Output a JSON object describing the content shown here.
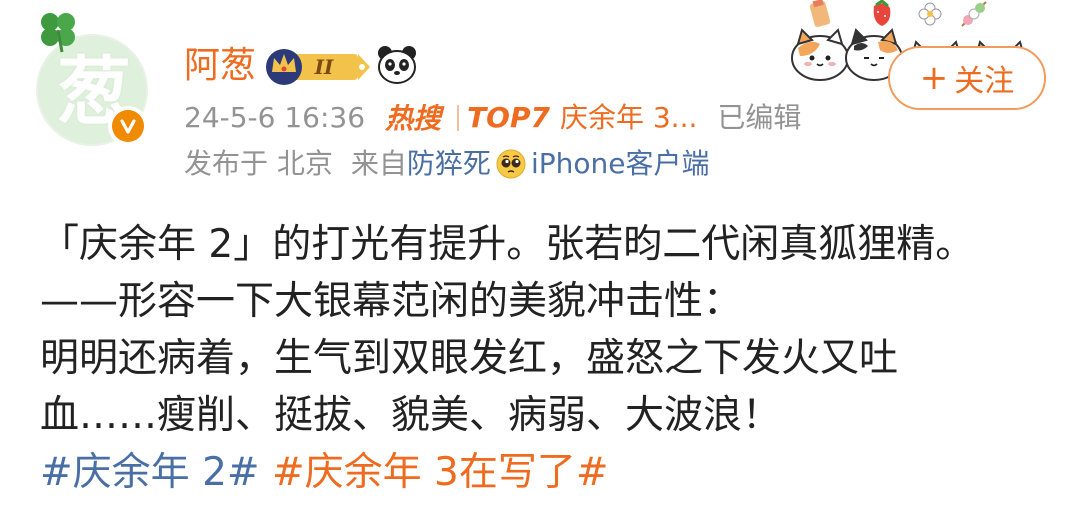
{
  "author": {
    "name": "阿葱",
    "avatar_glyph": "葱",
    "rank_badge": "II",
    "verified_mark": "v"
  },
  "meta": {
    "timestamp": "24-5-6 16:36",
    "hot_search_logo": "热搜",
    "hot_rank": "TOP7",
    "hot_topic": "庆余年 3...",
    "edited": "已编辑",
    "location": "发布于 北京",
    "source_prefix": "来自",
    "source_name": "防猝死",
    "source_suffix": "iPhone客户端"
  },
  "follow_button": {
    "plus": "+",
    "label": "关注"
  },
  "post": {
    "lines": [
      "「庆余年 2」的打光有提升。张若昀二代闲真狐狸精。",
      "——形容一下大银幕范闲的美貌冲击性：",
      "明明还病着，生气到双眼发红，盛怒之下发火又吐",
      "血……瘦削、挺拔、貌美、病弱、大波浪！"
    ],
    "tags": [
      {
        "text": "#庆余年 2#",
        "color": "#4a6fa5"
      },
      {
        "text": "#庆余年 3在写了#",
        "color": "#ee6b20"
      }
    ]
  },
  "colors": {
    "accent_orange": "#ee6b20",
    "link_blue": "#4a6fa5",
    "meta_gray": "#939393",
    "avatar_green": "#dff0dc"
  },
  "icons": [
    "clover-icon",
    "verified-icon",
    "crown-rank-icon",
    "panda-icon",
    "hot-search-logo",
    "pleading-face-emoji",
    "sticker-decoration"
  ]
}
